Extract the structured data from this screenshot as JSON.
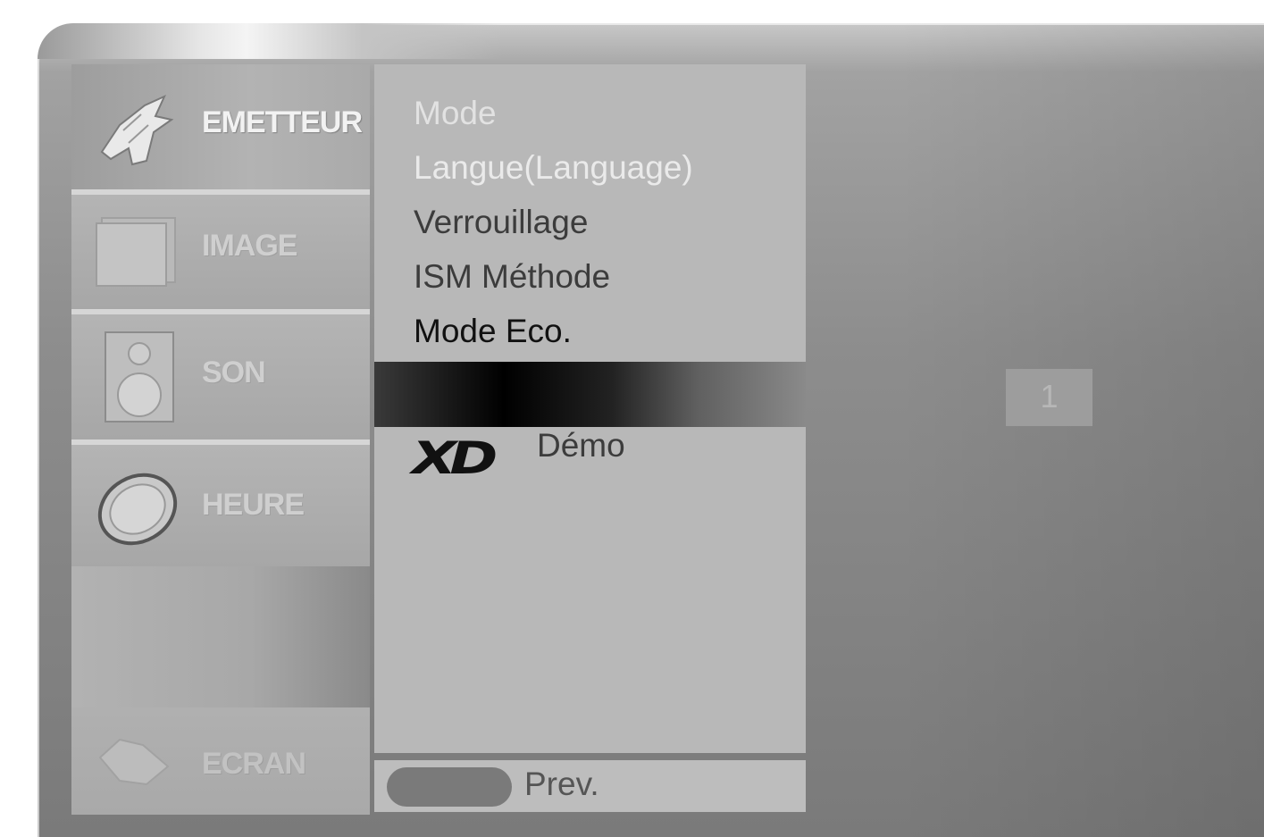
{
  "sidebar": {
    "items": [
      {
        "label": "EMETTEUR",
        "icon": "satellite-dish-icon",
        "active": true
      },
      {
        "label": "IMAGE",
        "icon": "picture-frame-icon",
        "active": false
      },
      {
        "label": "SON",
        "icon": "speaker-icon",
        "active": false
      },
      {
        "label": "HEURE",
        "icon": "clock-icon",
        "active": false
      },
      {
        "label": "ECRAN",
        "icon": "screen-icon",
        "active": false
      }
    ]
  },
  "submenu": {
    "items": [
      {
        "label": "Mode"
      },
      {
        "label": "Langue(Language)"
      },
      {
        "label": "Verrouillage"
      },
      {
        "label": "ISM Méthode"
      },
      {
        "label": "Mode Eco."
      }
    ],
    "logo": "XD",
    "demo_label": "Démo"
  },
  "footer": {
    "prev_label": "Prev."
  },
  "value": "1"
}
